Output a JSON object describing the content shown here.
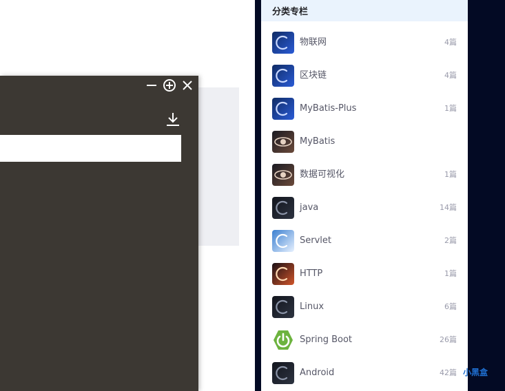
{
  "sidebar": {
    "header": "分类专栏",
    "categories": [
      {
        "name": "物联网",
        "count": "4篇",
        "thumb": "blue-c-icon"
      },
      {
        "name": "区块链",
        "count": "4篇",
        "thumb": "blue-c-icon"
      },
      {
        "name": "MyBatis-Plus",
        "count": "1篇",
        "thumb": "blue-c-icon"
      },
      {
        "name": "MyBatis",
        "count": "",
        "thumb": "eye-icon"
      },
      {
        "name": "数据可视化",
        "count": "1篇",
        "thumb": "eye-icon"
      },
      {
        "name": "java",
        "count": "14篇",
        "thumb": "dark-c-icon"
      },
      {
        "name": "Servlet",
        "count": "2篇",
        "thumb": "light-c-icon"
      },
      {
        "name": "HTTP",
        "count": "1篇",
        "thumb": "fire-c-icon"
      },
      {
        "name": "Linux",
        "count": "6篇",
        "thumb": "dark-c-icon"
      },
      {
        "name": "Spring Boot",
        "count": "26篇",
        "thumb": "spring-power-icon"
      },
      {
        "name": "Android",
        "count": "42篇",
        "thumb": "dark-c-icon"
      }
    ]
  },
  "watermark": "小黑盒",
  "popup": {
    "input_value": "",
    "buttons": [
      "minimize-icon",
      "add-circle-icon",
      "close-icon",
      "download-icon"
    ]
  },
  "colors": {
    "popup_bg": "#3c3833",
    "right_strip": "#030a24",
    "header_bg": "#eaf3fd",
    "spring_green": "#6db33f"
  }
}
